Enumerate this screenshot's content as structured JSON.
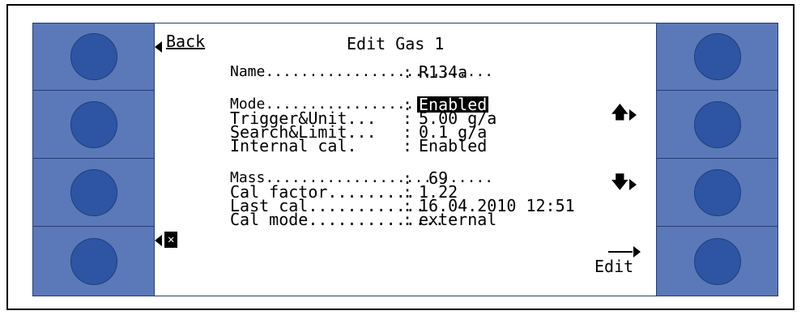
{
  "screen": {
    "title": "Edit Gas 1",
    "back_label": "Back",
    "edit_label": "Edit",
    "delete_glyph": "✕",
    "fields": [
      {
        "label": "Name..........................",
        "value": "R134a"
      },
      {
        "label": "Mode.........................",
        "value": "Enabled"
      },
      {
        "label": "Trigger&Unit...",
        "value": "5.00 g/a"
      },
      {
        "label": "Search&Limit...",
        "value": "0.1 g/a"
      },
      {
        "label": "Internal cal.",
        "value": "Enabled"
      },
      {
        "label": "Mass..........................",
        "value": " 69"
      },
      {
        "label": "Cal factor.........",
        "value": "1.22"
      },
      {
        "label": "Last cal............",
        "value": "16.04.2010 12:51"
      },
      {
        "label": "Cal mode..............",
        "value": "external"
      }
    ],
    "colon": ":",
    "up_arrow": "🡅",
    "down_arrow": "🡇"
  },
  "colors": {
    "panel": "#5b78b8",
    "button": "#2d55a3"
  }
}
